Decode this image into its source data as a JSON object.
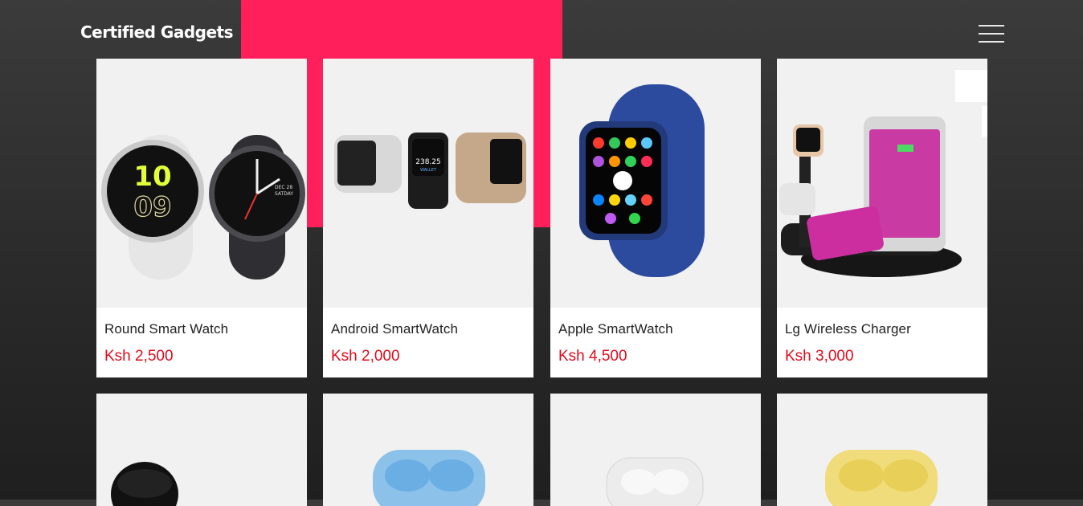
{
  "header": {
    "brand": "Certified Gadgets",
    "menu_icon": "hamburger-icon"
  },
  "colors": {
    "accent": "#ff1f5a",
    "price": "#e00b1c",
    "card_image_bg": "#f1f1f1"
  },
  "products_row1": [
    {
      "name": "Round Smart Watch",
      "price": "Ksh 2,500",
      "image": "round-smartwatch-image"
    },
    {
      "name": "Android SmartWatch",
      "price": "Ksh 2,000",
      "image": "android-smartwatch-image"
    },
    {
      "name": "Apple SmartWatch",
      "price": "Ksh 4,500",
      "image": "apple-smartwatch-image"
    },
    {
      "name": "Lg Wireless Charger",
      "price": "Ksh 3,000",
      "image": "wireless-charger-image"
    }
  ],
  "products_row2": [
    {
      "image": "black-earbuds-image"
    },
    {
      "image": "blue-earbuds-image"
    },
    {
      "image": "white-earbuds-image"
    },
    {
      "image": "yellow-earbuds-image"
    }
  ],
  "watch_faces": {
    "round_time_hours": "10",
    "round_time_minutes": "09",
    "round_date": "DEC 28",
    "round_day": "SATDAY",
    "android_reading": "238.25",
    "android_wallet": "WALLET"
  }
}
